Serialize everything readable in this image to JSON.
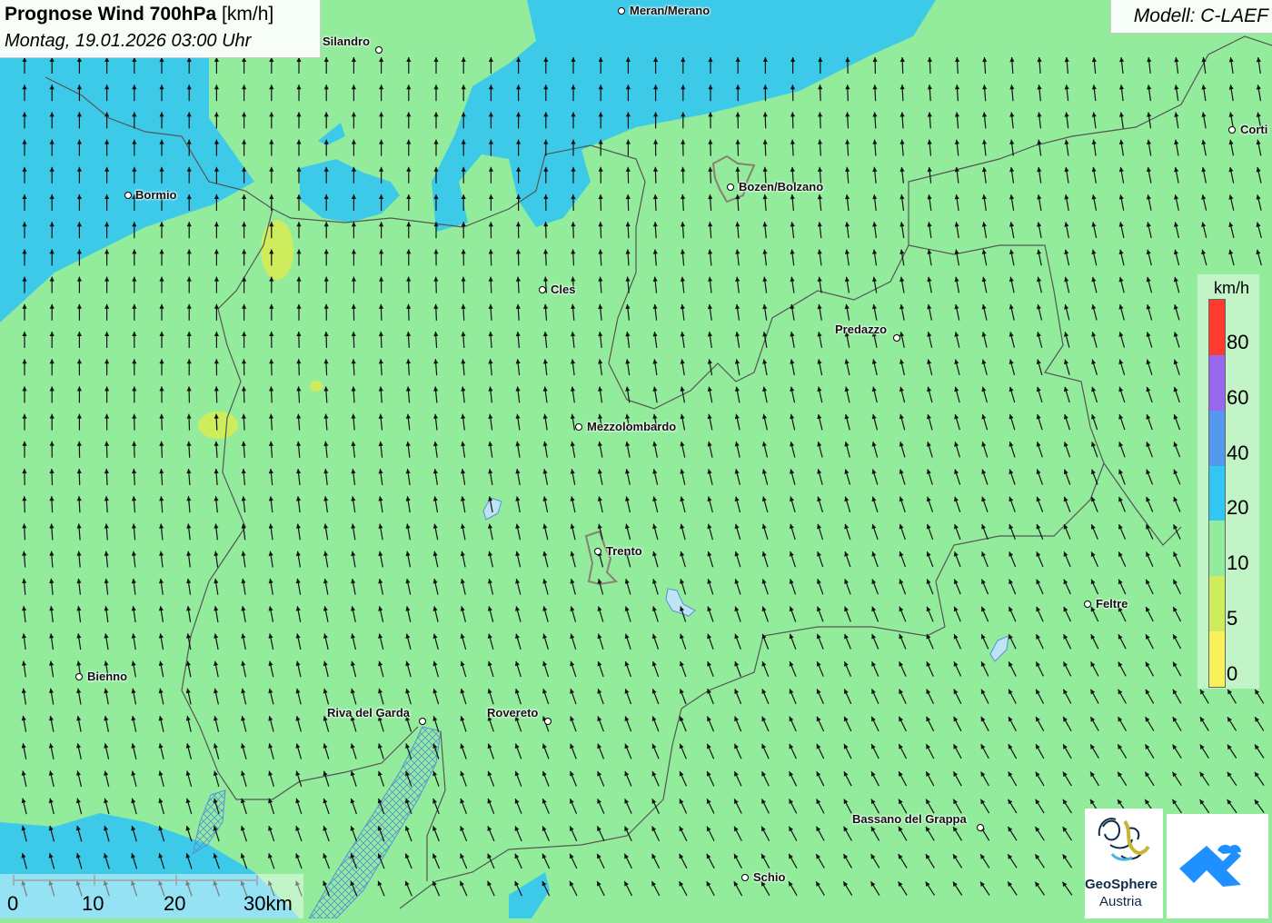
{
  "header": {
    "title_bold": "Prognose Wind 700hPa",
    "title_unit": "[km/h]",
    "subtitle": "Montag, 19.01.2026 03:00 Uhr"
  },
  "model_label": "Modell: C-LAEF",
  "legend": {
    "unit": "km/h",
    "steps": [
      {
        "label": "80",
        "color": "#ff3b30"
      },
      {
        "label": "60",
        "color": "#9966ee"
      },
      {
        "label": "40",
        "color": "#5599ee"
      },
      {
        "label": "20",
        "color": "#34c6f2"
      },
      {
        "label": "10",
        "color": "#92ec9c"
      },
      {
        "label": "5",
        "color": "#cfec5c"
      },
      {
        "label": "0",
        "color": "#f9f159"
      }
    ]
  },
  "cities": [
    {
      "name": "Meran/Merano"
    },
    {
      "name": "Silandro"
    },
    {
      "name": "Bormio"
    },
    {
      "name": "Bozen/Bolzano"
    },
    {
      "name": "Cles"
    },
    {
      "name": "Predazzo"
    },
    {
      "name": "Mezzolombardo"
    },
    {
      "name": "Trento"
    },
    {
      "name": "Feltre"
    },
    {
      "name": "Bienno"
    },
    {
      "name": "Riva del Garda"
    },
    {
      "name": "Rovereto"
    },
    {
      "name": "Bassano del Grappa"
    },
    {
      "name": "Schio"
    },
    {
      "name": "Corti"
    }
  ],
  "scale_bar": {
    "labels": [
      "0",
      "10",
      "20",
      "30km"
    ]
  },
  "logos": {
    "geosphere_line1": "GeoSphere",
    "geosphere_line2": "Austria"
  },
  "colors": {
    "wind_10_20": "#92ec9c",
    "wind_20_40": "#34c6f2",
    "wind_5_10": "#cfec5c",
    "arrow": "#111111",
    "border": "#555555",
    "logo_blue": "#1e90ff"
  }
}
